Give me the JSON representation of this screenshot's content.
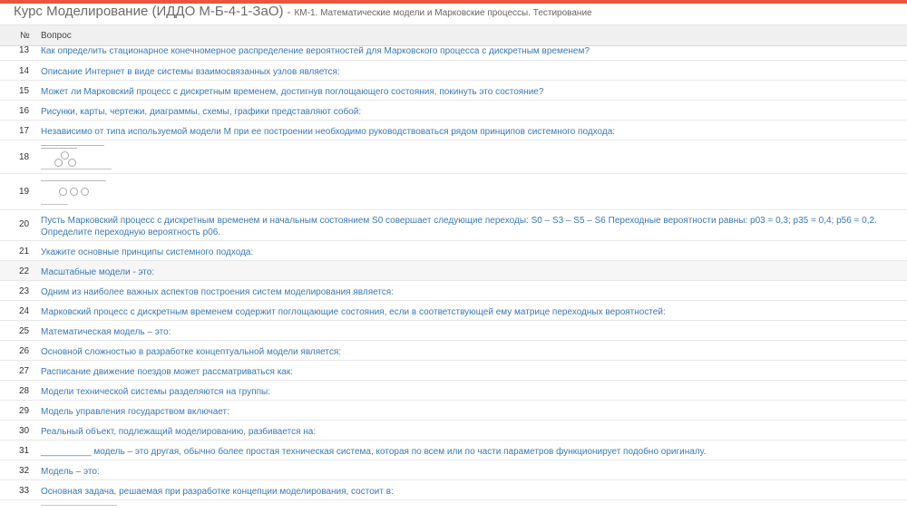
{
  "header": {
    "course_title": "Курс Моделирование (ИДДО М-Б-4-1-ЗаО)",
    "separator": "-",
    "subtitle": "КМ-1. Математические модели и Марковские процессы. Тестирование"
  },
  "table": {
    "col_num": "№",
    "col_question": "Вопрос",
    "rows": [
      {
        "num": "13",
        "text": "Как определить стационарное конечномерное распределение вероятностей для Марковского процесса с дискретным временем?"
      },
      {
        "num": "14",
        "text": "Описание Интернет в виде системы взаимосвязанных узлов является:"
      },
      {
        "num": "15",
        "text": "Может ли Марковский процесс с дискретным временем, достигнув поглощающего состояния, покинуть это состояние?"
      },
      {
        "num": "16",
        "text": "Рисунки, карты, чертежи, диаграммы, схемы, графики представляют собой:"
      },
      {
        "num": "17",
        "text": "Независимо от типа используемой модели М при ее построении необходимо руководствоваться рядом принципов системного подхода:"
      },
      {
        "num": "18",
        "text": ""
      },
      {
        "num": "19",
        "text": ""
      },
      {
        "num": "20",
        "text": "Пусть Марковский процесс с дискретным временем и начальным состоянием S0 совершает следующие переходы: S0 – S3 – S5 – S6 Переходные вероятности равны: p03 = 0,3; p35 = 0,4; p56 = 0,2. Определите переходную вероятность p06."
      },
      {
        "num": "21",
        "text": "Укажите основные принципы системного подхода:"
      },
      {
        "num": "22",
        "text": "Масштабные модели - это:"
      },
      {
        "num": "23",
        "text": "Одним из наиболее важных аспектов построения систем моделирования является:"
      },
      {
        "num": "24",
        "text": "Марковский процесс с дискретным временем содержит поглощающие состояния, если в соответствующей ему матрице переходных вероятностей:"
      },
      {
        "num": "25",
        "text": "Математическая модель – это:"
      },
      {
        "num": "26",
        "text": "Основной сложностью в разработке концептуальной модели является:"
      },
      {
        "num": "27",
        "text": "Расписание движение поездов может рассматриваться как:"
      },
      {
        "num": "28",
        "text": "Модели технической системы разделяются на группы:"
      },
      {
        "num": "29",
        "text": "Модель управления государством включает:"
      },
      {
        "num": "30",
        "text": "Реальный объект, подлежащий моделированию, разбивается на:"
      },
      {
        "num": "31",
        "text": "__________ модель – это другая, обычно более простая техническая система, которая по всем или по части параметров функционирует подобно оригиналу."
      },
      {
        "num": "32",
        "text": "Модель – это:"
      },
      {
        "num": "33",
        "text": "Основная задача, решаемая при разработке концепции моделирования, состоит в:"
      }
    ]
  },
  "colors": {
    "accent": "#e8563f",
    "link": "#3c78b6"
  }
}
